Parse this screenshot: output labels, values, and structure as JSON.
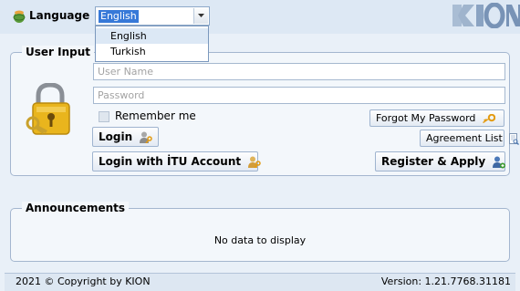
{
  "header": {
    "language_label": "Language",
    "language_selected": "English",
    "language_options": [
      "English",
      "Turkish"
    ],
    "logo_text": "KION"
  },
  "user_input": {
    "legend": "User Input",
    "username_placeholder": "User Name",
    "password_placeholder": "Password",
    "remember_label": "Remember me",
    "forgot_label": "Forgot My Password",
    "agreement_label": "Agreement List",
    "login_label": "Login",
    "itu_login_label": "Login with İTU Account",
    "register_label": "Register & Apply"
  },
  "announcements": {
    "legend": "Announcements",
    "empty_text": "No data to display"
  },
  "footer": {
    "copyright": "2021 © Copyright by KION",
    "version": "Version: 1.21.7768.31181"
  }
}
